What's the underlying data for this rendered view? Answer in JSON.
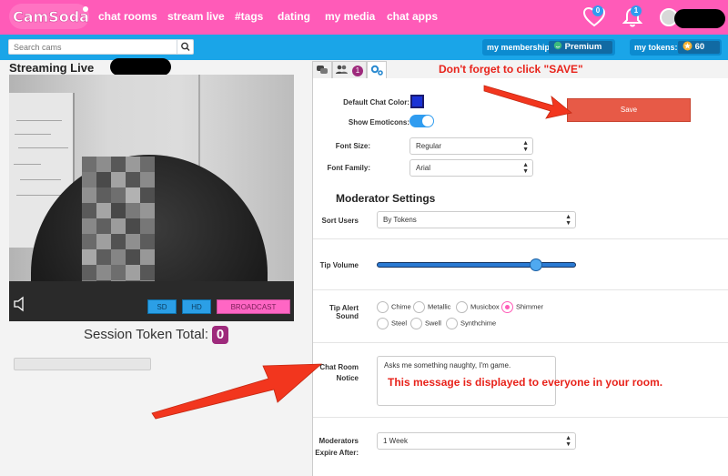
{
  "nav": {
    "logo_text": "CamSoda",
    "items": [
      {
        "label": "chat rooms"
      },
      {
        "label": "stream live"
      },
      {
        "label": "#tags"
      },
      {
        "label": "dating"
      },
      {
        "label": "my media"
      },
      {
        "label": "chat apps"
      }
    ],
    "heart_count": "0",
    "bell_count": "1",
    "colors": {
      "nav_bg": "#ff5bb8",
      "sub_bg": "#1aa5e8",
      "badge": "#2f9cf0"
    },
    "icons": [
      "heart-icon",
      "bell-icon",
      "avatar"
    ]
  },
  "subbar": {
    "search_placeholder": "Search cams",
    "membership_label": "my membership:",
    "premium_label": "Premium",
    "tokens_label": "my tokens:",
    "tokens_value": "60"
  },
  "stream": {
    "title": "Streaming Live",
    "buttons": {
      "sd": "SD",
      "hd": "HD",
      "broadcast": "BROADCAST"
    },
    "session_label": "Session Token Total:",
    "session_value": "0"
  },
  "settings": {
    "tab_badge": "1",
    "annotation_top": "Don't forget to click \"SAVE\"",
    "default_chat_color_label": "Default Chat Color:",
    "default_chat_color": "#1a32d6",
    "show_emoticons_label": "Show Emoticons:",
    "show_emoticons": true,
    "save_label": "Save",
    "font_size_label": "Font Size:",
    "font_size_value": "Regular",
    "font_family_label": "Font Family:",
    "font_family_value": "Arial",
    "moderator_title": "Moderator Settings",
    "sort_users_label": "Sort Users",
    "sort_users_value": "By Tokens",
    "tip_volume_label": "Tip Volume",
    "tip_volume_fraction": 0.8,
    "tip_alert_label": "Tip Alert Sound",
    "tip_alert_options": [
      "Chime",
      "Metallic",
      "Musicbox",
      "Shimmer",
      "Steel",
      "Swell",
      "Synthchime"
    ],
    "tip_alert_selected": "Shimmer",
    "notice_label_1": "Chat Room",
    "notice_label_2": "Notice",
    "notice_value": "Asks me something naughty, I'm game.",
    "annotation_mid": "This message is displayed to everyone in your room.",
    "moderators_label_1": "Moderators",
    "moderators_label_2": "Expire After:",
    "moderators_value": "1 Week"
  }
}
